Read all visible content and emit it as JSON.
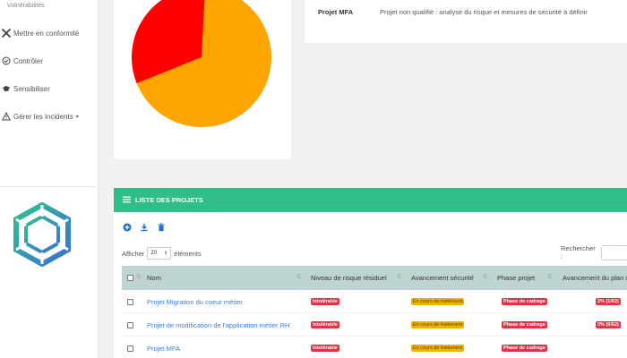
{
  "sidebar": {
    "partial_top": "Vulnérabilités",
    "items": [
      {
        "label": "Mettre en conformité",
        "icon": "tools-icon"
      },
      {
        "label": "Contrôler",
        "icon": "check-circle-icon"
      },
      {
        "label": "Sensibiliser",
        "icon": "graduation-cap-icon"
      },
      {
        "label": "Gérer les incidents",
        "icon": "warning-icon"
      }
    ]
  },
  "pie": {
    "colors": [
      "#ff0000",
      "#ffa500"
    ],
    "slices": [
      {
        "share": 0.32,
        "color": "#ff0000"
      },
      {
        "share": 0.68,
        "color": "#ffa500"
      }
    ]
  },
  "info": {
    "project": "Projet MFA",
    "description": "Projet non qualifié : analyse du risque et mesures de sécurité à définir"
  },
  "list": {
    "title": "LISTE DES PROJETS",
    "accent": "#2fbd8a",
    "length_prefix": "Afficher",
    "length_value": "20",
    "length_suffix": "éléments",
    "search_label": "Rechercher :",
    "columns": [
      "Nom",
      "Niveau de risque résiduel",
      "Avancement sécurité",
      "Phase projet",
      "Avancement du plan d"
    ],
    "rows": [
      {
        "name": "Projet Migration du coeur métier",
        "risk": "Intolérable",
        "progress": "En cours de traitement",
        "phase": "Phase de cadrage",
        "plan": "2% (1/62)"
      },
      {
        "name": "Projet de modification de l'application métier RH",
        "risk": "Intolérable",
        "progress": "En cours de traitement",
        "phase": "Phase de cadrage",
        "plan": "0% (0/52)"
      },
      {
        "name": "Projet MFA",
        "risk": "Intolérable",
        "progress": "En cours de traitement",
        "phase": "Phase de cadrage",
        "plan": ""
      }
    ]
  }
}
